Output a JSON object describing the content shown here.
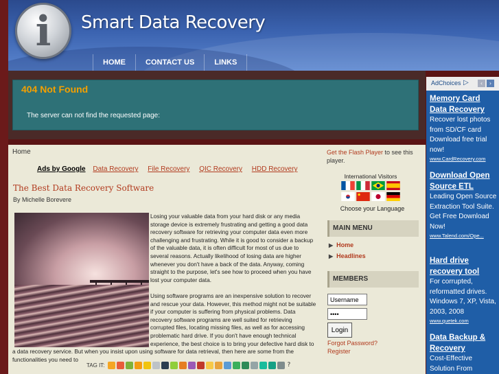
{
  "site": {
    "title": "Smart Data Recovery",
    "logo_letter": "i"
  },
  "nav": {
    "items": [
      "HOME",
      "CONTACT US",
      "LINKS"
    ]
  },
  "error": {
    "title": "404 Not Found",
    "message": "The server can not find the requested page:"
  },
  "breadcrumb": "Home",
  "ad_links": {
    "label": "Ads by Google",
    "items": [
      "Data Recovery",
      "File Recovery",
      "QIC Recovery",
      "HDD Recovery"
    ]
  },
  "article": {
    "title": "The Best Data Recovery Software",
    "byline": "By Michelle Borevere",
    "paragraphs": [
      "Losing your valuable data from your hard disk or any media storage device is extremely frustrating and getting a good data recovery software for retrieving your computer data even more challenging and frustrating. While it is good to consider a backup of the valuable data, it is often difficult for most of us due to several reasons. Actually likelihood of losing data are higher whenever you don't have a back of the data. Anyway, coming straight to the purpose, let's see how to proceed when you have lost your computer data.",
      "Using software programs are an inexpensive solution to recover and rescue your data. However, this method might not be suitable if your computer is suffering from physical problems. Data recovery software programs are well suited for retrieving corrupted files, locating missing files, as well as for accessing problematic hard drive. If you don't have enough technical experience, the best choice is to bring your defective hard disk to a data recovery service. But when you insist upon using software for data retrieval, then here are some from the functionalities you need to"
    ],
    "tag_label": "TAG IT:",
    "tag_help": "?"
  },
  "tag_colors": [
    "#f5a623",
    "#e85d3a",
    "#7fb23a",
    "#f39c12",
    "#f1c40f",
    "#bdc3c7",
    "#2c3e50",
    "#8fce3a",
    "#e67e22",
    "#9b59b6",
    "#c0392b",
    "#f7c948",
    "#e8a33d",
    "#5b9bd5",
    "#3aaf5c",
    "#2e8b57",
    "#95a5a6",
    "#1abc9c",
    "#16a085",
    "#7f8c8d"
  ],
  "sidebar": {
    "flash_link": "Get the Flash Player",
    "flash_rest": " to see this player.",
    "visitors_label": "International Visitors",
    "choose_language": "Choose your Language",
    "main_menu": {
      "title": "MAIN MENU",
      "items": [
        "Home",
        "Headlines"
      ]
    },
    "members": {
      "title": "MEMBERS",
      "username_value": "Username",
      "password_value": "••••",
      "login_label": "Login",
      "forgot": "Forgot Password?",
      "register": "Register"
    }
  },
  "ads": {
    "choices_label": "AdChoices",
    "items": [
      {
        "title": "Memory Card Data Recovery",
        "desc": "Recover lost photos from SD/CF card Download free trial now!",
        "url": "www.CardRecovery.com"
      },
      {
        "title": "Download Open Source ETL",
        "desc": "Leading Open Source Extraction Tool Suite. Get Free Download Now!",
        "url": "www.Talend.com/Ope..."
      },
      {
        "title": "Hard drive recovery tool",
        "desc": "For corrupted, reformatted drives. Windows 7, XP, Vista, 2003, 2008",
        "url": "www.quetek.com"
      },
      {
        "title": "Data Backup & Recovery",
        "desc": "Cost-Effective Solution From",
        "url": ""
      }
    ]
  }
}
